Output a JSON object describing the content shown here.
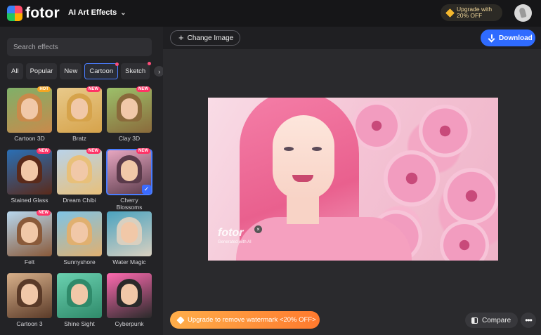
{
  "app": {
    "brand": "fotor"
  },
  "header": {
    "menu_label": "AI Art Effects",
    "upgrade_line1": "Upgrade with",
    "upgrade_line2": "20% OFF"
  },
  "sidebar": {
    "search_placeholder": "Search effects",
    "filters": [
      {
        "label": "All"
      },
      {
        "label": "Popular"
      },
      {
        "label": "New"
      },
      {
        "label": "Cartoon",
        "active": true,
        "dot": true
      },
      {
        "label": "Sketch",
        "dot": true
      }
    ],
    "effects": [
      {
        "label": "Cartoon 3D",
        "badge": "HOT",
        "colors": [
          "#c98a4b",
          "#7fb069"
        ]
      },
      {
        "label": "Bratz",
        "badge": "NEW",
        "colors": [
          "#d6a34b",
          "#e8c98a"
        ]
      },
      {
        "label": "Clay 3D",
        "badge": "NEW",
        "colors": [
          "#8a6a3b",
          "#9cc06a"
        ]
      },
      {
        "label": "Stained Glass",
        "badge": "NEW",
        "colors": [
          "#5a2a1a",
          "#2a6fb5"
        ]
      },
      {
        "label": "Dream Chibi",
        "badge": "NEW",
        "colors": [
          "#e8c07a",
          "#b9d3ea"
        ]
      },
      {
        "label": "Cherry\nBlossoms",
        "badge": "NEW",
        "selected": true,
        "colors": [
          "#5a3a4a",
          "#e9a8c2"
        ]
      },
      {
        "label": "Felt",
        "badge": "NEW",
        "colors": [
          "#8a5a3a",
          "#b7d7ee"
        ]
      },
      {
        "label": "Sunnyshore",
        "colors": [
          "#e0b070",
          "#7ec4e6"
        ]
      },
      {
        "label": "Water Magic",
        "colors": [
          "#d9d0c0",
          "#4aa3c0"
        ]
      },
      {
        "label": "Cartoon 3",
        "colors": [
          "#5a3a28",
          "#d8b08a"
        ]
      },
      {
        "label": "Shine Sight",
        "colors": [
          "#2f8a6a",
          "#6ad1b0"
        ]
      },
      {
        "label": "Cyberpunk",
        "colors": [
          "#2a2a2a",
          "#ff6ab0"
        ]
      }
    ]
  },
  "toolbar": {
    "change_image_label": "Change Image",
    "download_label": "Download"
  },
  "preview": {
    "watermark_logo": "fotor",
    "watermark_sub": "Generated with AI"
  },
  "footer": {
    "promo_label": "Upgrade to remove watermark <20% OFF>",
    "compare_label": "Compare"
  },
  "icons": {
    "menu_chevron": "chevron-down-icon",
    "next": "chevron-right-icon",
    "add": "plus-icon",
    "download": "download-icon",
    "compare": "compare-icon",
    "more": "more-horizontal-icon"
  },
  "colors": {
    "accent": "#2f6bff",
    "promo": "#ff8a36",
    "badge_new": "#ff3366",
    "badge_hot": "#f5a623"
  }
}
